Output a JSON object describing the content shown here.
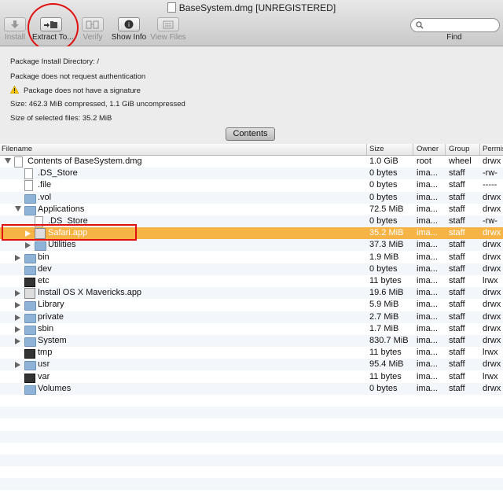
{
  "window": {
    "title": "BaseSystem.dmg [UNREGISTERED]"
  },
  "toolbar": {
    "install": "Install",
    "extract": "Extract To...",
    "verify": "Verify",
    "show_info": "Show Info",
    "view_files": "View Files",
    "find": "Find"
  },
  "info": {
    "install_dir": "Package Install Directory: /",
    "auth": "Package does not request authentication",
    "signature": "Package does not have a signature",
    "size": "Size: 462.3 MiB compressed, 1.1 GiB uncompressed",
    "selected": "Size of selected files: 35.2 MiB"
  },
  "contents_button": "Contents",
  "columns": {
    "filename": "Filename",
    "size": "Size",
    "owner": "Owner",
    "group": "Group",
    "perms": "Permis"
  },
  "rows": [
    {
      "name": "Contents of BaseSystem.dmg",
      "size": "1.0 GiB",
      "owner": "root",
      "group": "wheel",
      "perm": "drwx",
      "icon": "file-icon",
      "disclosure": "down",
      "indent": 0
    },
    {
      "name": ".DS_Store",
      "size": "0 bytes",
      "owner": "ima...",
      "group": "staff",
      "perm": "-rw-",
      "icon": "file-icon",
      "disclosure": "none",
      "indent": 1
    },
    {
      "name": ".file",
      "size": "0 bytes",
      "owner": "ima...",
      "group": "staff",
      "perm": "-----",
      "icon": "file-icon",
      "disclosure": "none",
      "indent": 1
    },
    {
      "name": ".vol",
      "size": "0 bytes",
      "owner": "ima...",
      "group": "staff",
      "perm": "drwx",
      "icon": "folder-icon",
      "disclosure": "none",
      "indent": 1
    },
    {
      "name": "Applications",
      "size": "72.5 MiB",
      "owner": "ima...",
      "group": "staff",
      "perm": "drwx",
      "icon": "folder-icon",
      "disclosure": "down",
      "indent": 1
    },
    {
      "name": ".DS_Store",
      "size": "0 bytes",
      "owner": "ima...",
      "group": "staff",
      "perm": "-rw-",
      "icon": "file-icon",
      "disclosure": "none",
      "indent": 2
    },
    {
      "name": "Safari.app",
      "size": "35.2 MiB",
      "owner": "ima...",
      "group": "staff",
      "perm": "drwx",
      "icon": "app-icon",
      "disclosure": "right",
      "indent": 2,
      "selected": true
    },
    {
      "name": "Utilities",
      "size": "37.3 MiB",
      "owner": "ima...",
      "group": "staff",
      "perm": "drwx",
      "icon": "folder-icon",
      "disclosure": "right",
      "indent": 2
    },
    {
      "name": "bin",
      "size": "1.9 MiB",
      "owner": "ima...",
      "group": "staff",
      "perm": "drwx",
      "icon": "folder-icon",
      "disclosure": "right",
      "indent": 1
    },
    {
      "name": "dev",
      "size": "0 bytes",
      "owner": "ima...",
      "group": "staff",
      "perm": "drwx",
      "icon": "folder-icon",
      "disclosure": "none",
      "indent": 1
    },
    {
      "name": "etc",
      "size": "11 bytes",
      "owner": "ima...",
      "group": "staff",
      "perm": "lrwx",
      "icon": "terminal-icon",
      "disclosure": "none",
      "indent": 1
    },
    {
      "name": "Install OS X Mavericks.app",
      "size": "19.6 MiB",
      "owner": "ima...",
      "group": "staff",
      "perm": "drwx",
      "icon": "app-icon",
      "disclosure": "right",
      "indent": 1
    },
    {
      "name": "Library",
      "size": "5.9 MiB",
      "owner": "ima...",
      "group": "staff",
      "perm": "drwx",
      "icon": "folder-icon",
      "disclosure": "right",
      "indent": 1
    },
    {
      "name": "private",
      "size": "2.7 MiB",
      "owner": "ima...",
      "group": "staff",
      "perm": "drwx",
      "icon": "folder-icon",
      "disclosure": "right",
      "indent": 1
    },
    {
      "name": "sbin",
      "size": "1.7 MiB",
      "owner": "ima...",
      "group": "staff",
      "perm": "drwx",
      "icon": "folder-icon",
      "disclosure": "right",
      "indent": 1
    },
    {
      "name": "System",
      "size": "830.7 MiB",
      "owner": "ima...",
      "group": "staff",
      "perm": "drwx",
      "icon": "folder-icon",
      "disclosure": "right",
      "indent": 1
    },
    {
      "name": "tmp",
      "size": "11 bytes",
      "owner": "ima...",
      "group": "staff",
      "perm": "lrwx",
      "icon": "terminal-icon",
      "disclosure": "none",
      "indent": 1
    },
    {
      "name": "usr",
      "size": "95.4 MiB",
      "owner": "ima...",
      "group": "staff",
      "perm": "drwx",
      "icon": "folder-icon",
      "disclosure": "right",
      "indent": 1
    },
    {
      "name": "var",
      "size": "11 bytes",
      "owner": "ima...",
      "group": "staff",
      "perm": "lrwx",
      "icon": "terminal-icon",
      "disclosure": "none",
      "indent": 1
    },
    {
      "name": "Volumes",
      "size": "0 bytes",
      "owner": "ima...",
      "group": "staff",
      "perm": "drwx",
      "icon": "folder-icon",
      "disclosure": "none",
      "indent": 1
    }
  ],
  "colors": {
    "selection": "#f7b446",
    "annotation": "#e01010"
  }
}
